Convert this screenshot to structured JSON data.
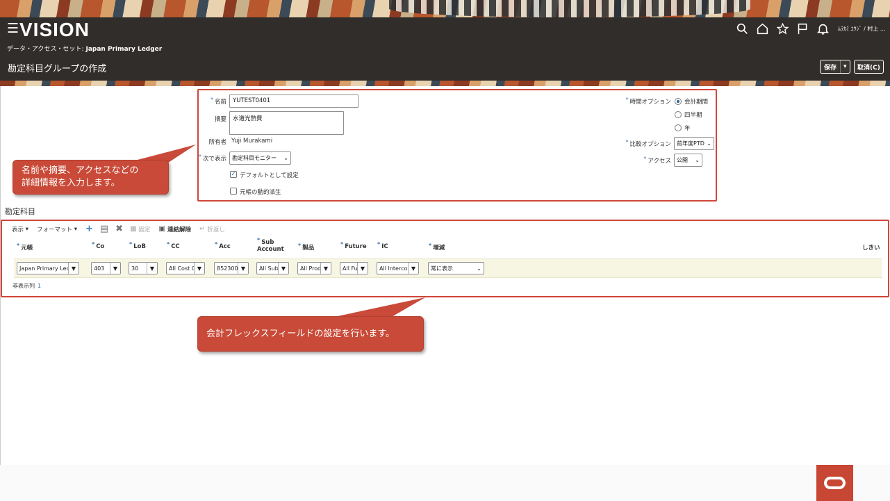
{
  "app": {
    "logo": "VISION",
    "data_access_set_label": "データ・アクセス・セット:",
    "data_access_set_value": "Japan Primary Ledger",
    "page_title": "勘定科目グループの作成",
    "user_name": "ﾑﾗｶﾐ ﾕｳｼﾞ / 村上 ...",
    "save_label": "保存",
    "cancel_label": "取消(C)"
  },
  "form": {
    "name_label": "名前",
    "name_value": "YUTEST0401",
    "description_label": "摘要",
    "description_value": "水道光熱費",
    "owner_label": "所有者",
    "owner_value": "Yuji Murakami",
    "display_in_label": "次で表示",
    "display_in_value": "勘定科目モニター",
    "default_label": "デフォルトとして設定",
    "derive_ledger_label": "元帳の動的派生",
    "time_option_label": "時間オプション",
    "time_options": [
      "会計期間",
      "四半期",
      "年"
    ],
    "comparison_label": "比較オプション",
    "comparison_value": "前年度PTD",
    "access_label": "アクセス",
    "access_value": "公開"
  },
  "callouts": {
    "top": "名前や摘要、アクセスなどの\n詳細情報を入力します。",
    "bottom": "会計フレックスフィールドの設定を行います。"
  },
  "accounts": {
    "section_title": "勘定科目",
    "toolbar": {
      "view": "表示",
      "format": "フォーマット",
      "freeze": "固定",
      "detach": "連結解除",
      "wrap": "折返し"
    },
    "columns": [
      "元帳",
      "Co",
      "LoB",
      "CC",
      "Acc",
      "Sub Account",
      "製品",
      "Future",
      "IC",
      "増減"
    ],
    "threshold_col": "しきい",
    "row": [
      "Japan Primary Led",
      "403",
      "30",
      "All Cost C",
      "852300",
      "All Sub",
      "All Prod",
      "All Fu",
      "All Intercor",
      "常に表示"
    ],
    "hidden_columns_label": "非表示列",
    "hidden_columns_count": "1"
  }
}
